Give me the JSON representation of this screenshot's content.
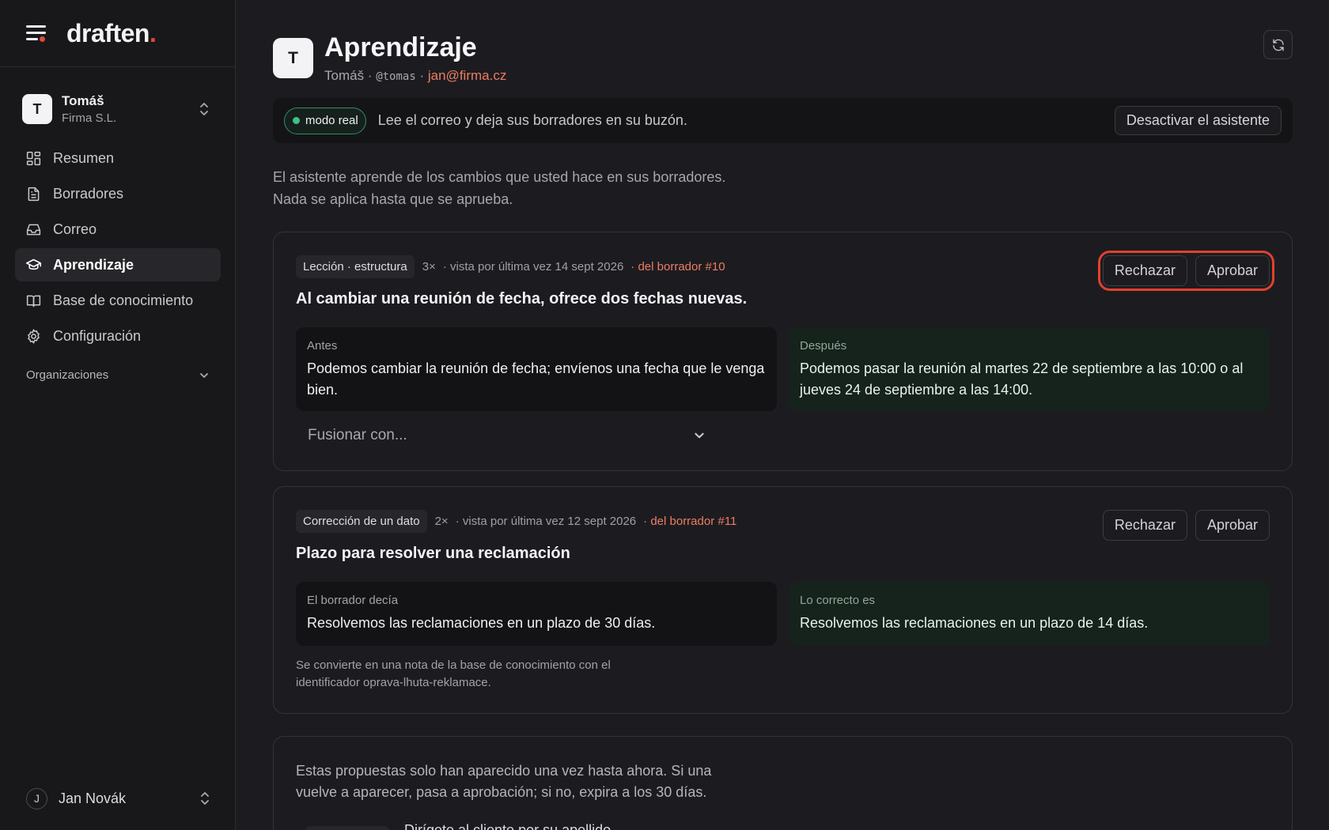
{
  "brand": {
    "logo_text": "draften",
    "logo_dot": ".",
    "accent": "#e0483a"
  },
  "workspace": {
    "initial": "T",
    "name": "Tomáš",
    "company": "Firma S.L."
  },
  "nav": {
    "items": [
      {
        "label": "Resumen",
        "icon": "dashboard-icon"
      },
      {
        "label": "Borradores",
        "icon": "document-icon"
      },
      {
        "label": "Correo",
        "icon": "inbox-icon"
      },
      {
        "label": "Aprendizaje",
        "icon": "graduation-cap-icon",
        "active": true
      },
      {
        "label": "Base de conocimiento",
        "icon": "book-icon"
      },
      {
        "label": "Configuración",
        "icon": "gear-icon"
      }
    ],
    "organizations_label": "Organizaciones"
  },
  "user": {
    "initial": "J",
    "name": "Jan Novák"
  },
  "header": {
    "avatar_initial": "T",
    "title": "Aprendizaje",
    "sub_name": "Tomáš",
    "sep1": " · ",
    "handle": "@tomas",
    "sep2": " · ",
    "email": "jan@firma.cz"
  },
  "mode_bar": {
    "badge": "modo real",
    "text": "Lee el correo y deja sus borradores en su buzón.",
    "button": "Desactivar el asistente"
  },
  "intro": {
    "line1": "El asistente aprende de los cambios que usted hace en sus borradores.",
    "line2": "Nada se aplica hasta que se aprueba."
  },
  "lessons": [
    {
      "tag": "Lección · estructura",
      "count": "3×",
      "seen": "· vista por última vez 14 sept 2026",
      "link": "· del borrador #10",
      "title": "Al cambiar una reunión de fecha, ofrece dos fechas nuevas.",
      "before_label": "Antes",
      "before_text": "Podemos cambiar la reunión de fecha; envíenos una fecha que le venga bien.",
      "after_label": "Después",
      "after_text": "Podemos pasar la reunión al martes 22 de septiembre a las 10:00 o al jueves 24 de septiembre a las 14:00.",
      "merge_placeholder": "Fusionar con...",
      "reject": "Rechazar",
      "approve": "Aprobar"
    },
    {
      "tag": "Corrección de un dato",
      "count": "2×",
      "seen": "· vista por última vez 12 sept 2026",
      "link": "· del borrador #11",
      "title": "Plazo para resolver una reclamación",
      "before_label": "El borrador decía",
      "before_text": "Resolvemos las reclamaciones en un plazo de 30 días.",
      "after_label": "Lo correcto es",
      "after_text": "Resolvemos las reclamaciones en un plazo de 14 días.",
      "note": "Se convierte en una nota de la base de conocimiento con el identificador oprava-lhuta-reklamace.",
      "reject": "Rechazar",
      "approve": "Aprobar"
    }
  ],
  "pending": {
    "text": "Estas propuestas solo han aparecido una vez hasta ahora. Si una vuelve a aparecer, pasa a aprobación; si no, expira a los 30 días.",
    "next_item": "Dirígete al cliente por su apellido"
  }
}
